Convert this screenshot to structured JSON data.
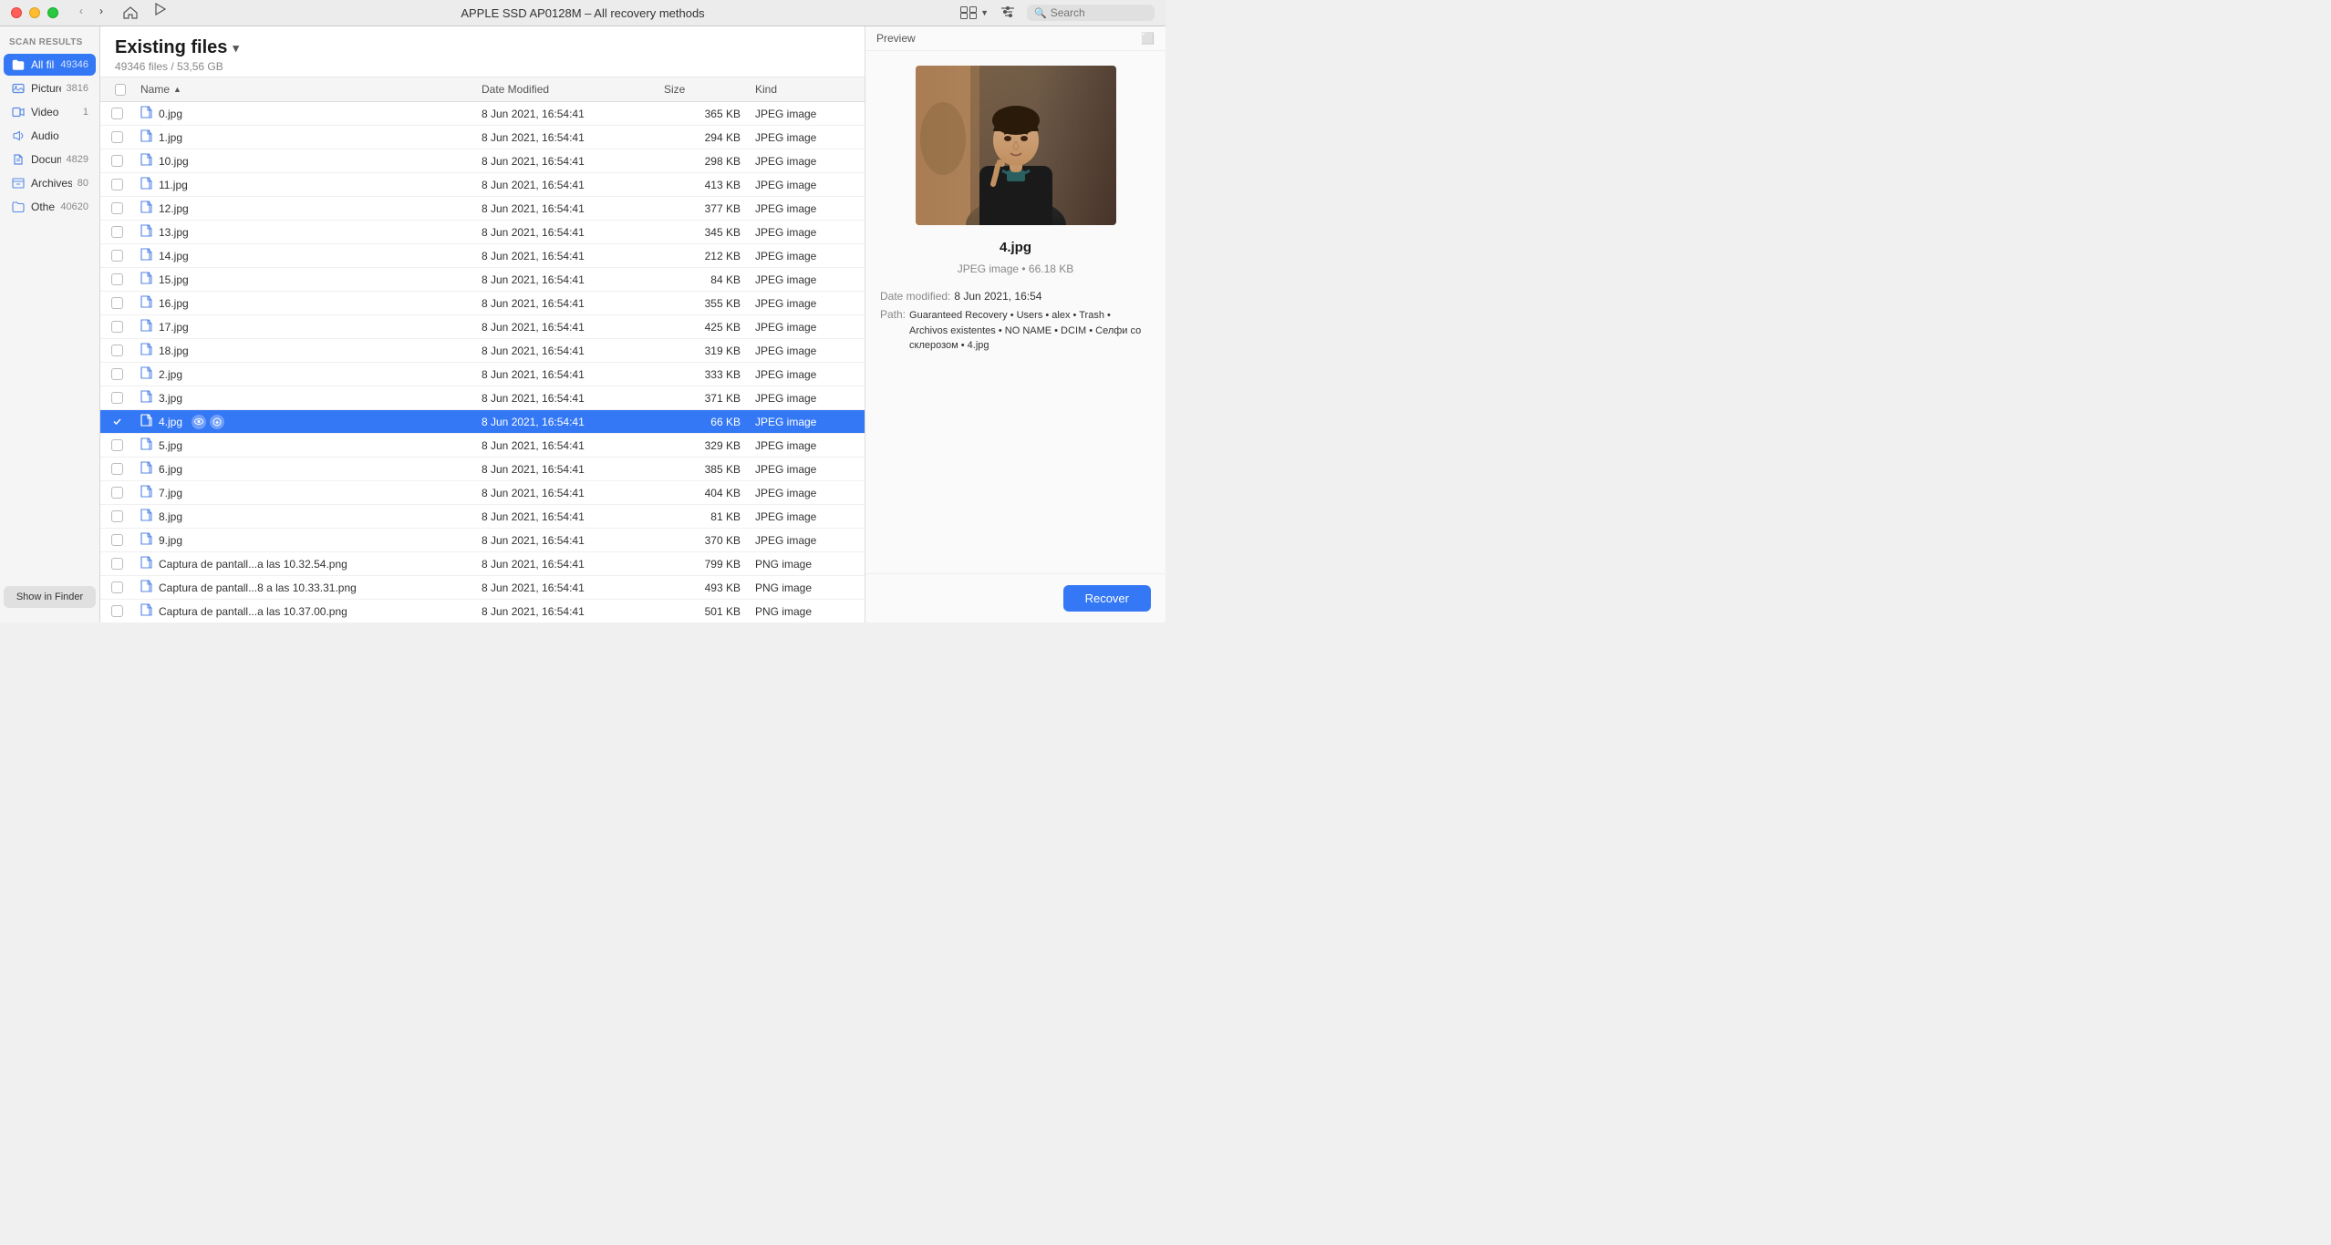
{
  "titlebar": {
    "title": "APPLE SSD AP0128M – All recovery methods",
    "search_placeholder": "Search"
  },
  "sidebar": {
    "section_label": "Scan results",
    "items": [
      {
        "id": "all-files",
        "label": "All files",
        "count": "49346",
        "icon": "🗂️",
        "active": true
      },
      {
        "id": "pictures",
        "label": "Pictures",
        "count": "3816",
        "icon": "🖼️",
        "active": false
      },
      {
        "id": "video",
        "label": "Video",
        "count": "1",
        "icon": "🎬",
        "active": false
      },
      {
        "id": "audio",
        "label": "Audio",
        "count": "",
        "icon": "🎵",
        "active": false
      },
      {
        "id": "documents",
        "label": "Documents",
        "count": "4829",
        "icon": "📋",
        "active": false
      },
      {
        "id": "archives",
        "label": "Archives",
        "count": "80",
        "icon": "🗃️",
        "active": false
      },
      {
        "id": "other",
        "label": "Other",
        "count": "40620",
        "icon": "📁",
        "active": false
      }
    ],
    "show_finder_label": "Show in Finder"
  },
  "content": {
    "title": "Existing files",
    "subtitle": "49346 files / 53,56 GB",
    "columns": {
      "name": "Name",
      "date_modified": "Date Modified",
      "size": "Size",
      "kind": "Kind"
    },
    "rows": [
      {
        "id": "r0",
        "name": "0.jpg",
        "date": "8 Jun 2021, 16:54:41",
        "size": "365 KB",
        "kind": "JPEG image",
        "selected": false,
        "checked": false
      },
      {
        "id": "r1",
        "name": "1.jpg",
        "date": "8 Jun 2021, 16:54:41",
        "size": "294 KB",
        "kind": "JPEG image",
        "selected": false,
        "checked": false
      },
      {
        "id": "r2",
        "name": "10.jpg",
        "date": "8 Jun 2021, 16:54:41",
        "size": "298 KB",
        "kind": "JPEG image",
        "selected": false,
        "checked": false
      },
      {
        "id": "r3",
        "name": "11.jpg",
        "date": "8 Jun 2021, 16:54:41",
        "size": "413 KB",
        "kind": "JPEG image",
        "selected": false,
        "checked": false
      },
      {
        "id": "r4",
        "name": "12.jpg",
        "date": "8 Jun 2021, 16:54:41",
        "size": "377 KB",
        "kind": "JPEG image",
        "selected": false,
        "checked": false
      },
      {
        "id": "r5",
        "name": "13.jpg",
        "date": "8 Jun 2021, 16:54:41",
        "size": "345 KB",
        "kind": "JPEG image",
        "selected": false,
        "checked": false
      },
      {
        "id": "r6",
        "name": "14.jpg",
        "date": "8 Jun 2021, 16:54:41",
        "size": "212 KB",
        "kind": "JPEG image",
        "selected": false,
        "checked": false
      },
      {
        "id": "r7",
        "name": "15.jpg",
        "date": "8 Jun 2021, 16:54:41",
        "size": "84 KB",
        "kind": "JPEG image",
        "selected": false,
        "checked": false
      },
      {
        "id": "r8",
        "name": "16.jpg",
        "date": "8 Jun 2021, 16:54:41",
        "size": "355 KB",
        "kind": "JPEG image",
        "selected": false,
        "checked": false
      },
      {
        "id": "r9",
        "name": "17.jpg",
        "date": "8 Jun 2021, 16:54:41",
        "size": "425 KB",
        "kind": "JPEG image",
        "selected": false,
        "checked": false
      },
      {
        "id": "r10",
        "name": "18.jpg",
        "date": "8 Jun 2021, 16:54:41",
        "size": "319 KB",
        "kind": "JPEG image",
        "selected": false,
        "checked": false
      },
      {
        "id": "r11",
        "name": "2.jpg",
        "date": "8 Jun 2021, 16:54:41",
        "size": "333 KB",
        "kind": "JPEG image",
        "selected": false,
        "checked": false
      },
      {
        "id": "r12",
        "name": "3.jpg",
        "date": "8 Jun 2021, 16:54:41",
        "size": "371 KB",
        "kind": "JPEG image",
        "selected": false,
        "checked": false
      },
      {
        "id": "r13",
        "name": "4.jpg",
        "date": "8 Jun 2021, 16:54:41",
        "size": "66 KB",
        "kind": "JPEG image",
        "selected": true,
        "checked": true
      },
      {
        "id": "r14",
        "name": "5.jpg",
        "date": "8 Jun 2021, 16:54:41",
        "size": "329 KB",
        "kind": "JPEG image",
        "selected": false,
        "checked": false
      },
      {
        "id": "r15",
        "name": "6.jpg",
        "date": "8 Jun 2021, 16:54:41",
        "size": "385 KB",
        "kind": "JPEG image",
        "selected": false,
        "checked": false
      },
      {
        "id": "r16",
        "name": "7.jpg",
        "date": "8 Jun 2021, 16:54:41",
        "size": "404 KB",
        "kind": "JPEG image",
        "selected": false,
        "checked": false
      },
      {
        "id": "r17",
        "name": "8.jpg",
        "date": "8 Jun 2021, 16:54:41",
        "size": "81 KB",
        "kind": "JPEG image",
        "selected": false,
        "checked": false
      },
      {
        "id": "r18",
        "name": "9.jpg",
        "date": "8 Jun 2021, 16:54:41",
        "size": "370 KB",
        "kind": "JPEG image",
        "selected": false,
        "checked": false
      },
      {
        "id": "r19",
        "name": "Captura de pantall...a las 10.32.54.png",
        "date": "8 Jun 2021, 16:54:41",
        "size": "799 KB",
        "kind": "PNG image",
        "selected": false,
        "checked": false
      },
      {
        "id": "r20",
        "name": "Captura de pantall...8 a las 10.33.31.png",
        "date": "8 Jun 2021, 16:54:41",
        "size": "493 KB",
        "kind": "PNG image",
        "selected": false,
        "checked": false
      },
      {
        "id": "r21",
        "name": "Captura de pantall...a las 10.37.00.png",
        "date": "8 Jun 2021, 16:54:41",
        "size": "501 KB",
        "kind": "PNG image",
        "selected": false,
        "checked": false
      }
    ]
  },
  "preview": {
    "title": "Preview",
    "filename": "4.jpg",
    "type_size": "JPEG image • 66.18 KB",
    "date_label": "Date modified:",
    "date_value": "8 Jun 2021, 16:54",
    "path_label": "Path:",
    "path_value": "Guaranteed Recovery • Users • alex • Trash • Archivos existentes • NO NAME • DCIM • Селфи со склерозом • 4.jpg"
  },
  "recover_button_label": "Recover"
}
